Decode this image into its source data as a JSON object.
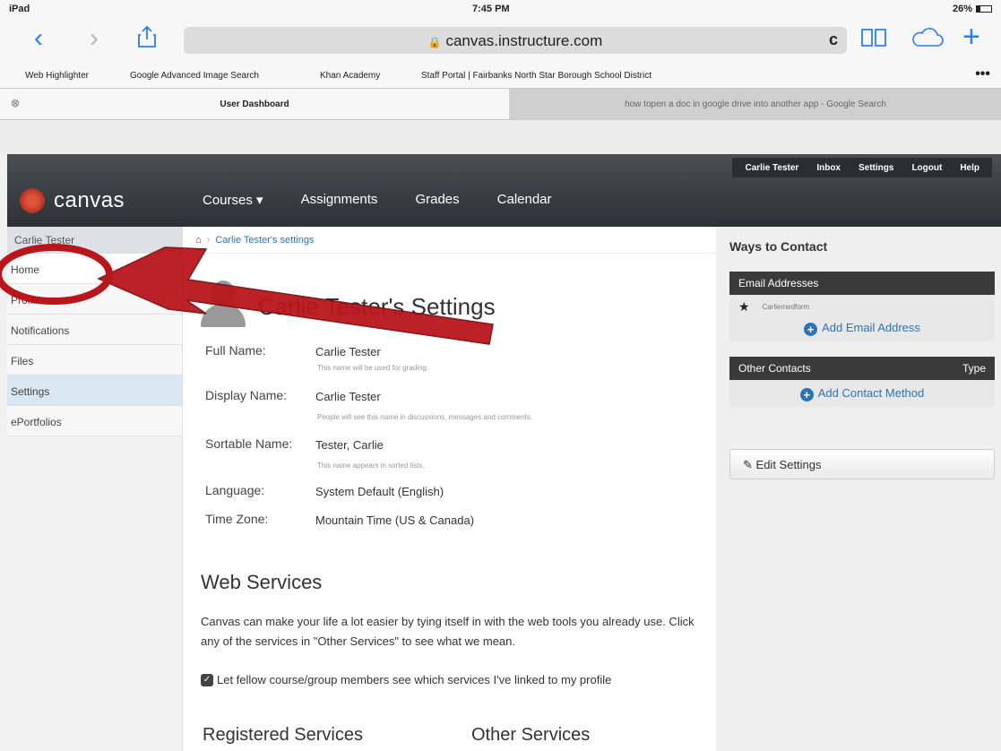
{
  "status_bar": {
    "device": "iPad",
    "time": "7:45 PM",
    "battery": "26%",
    "battery_level": 0.26
  },
  "browser": {
    "url": "canvas.instructure.com",
    "bookmarks": [
      "Web Highlighter",
      "Google Advanced Image Search",
      "Khan Academy",
      "Staff Portal | Fairbanks North Star Borough School District"
    ],
    "tabs": [
      {
        "title": "User Dashboard",
        "active": true
      },
      {
        "title": "how topen a doc in google drive into another app - Google Search",
        "active": false
      }
    ]
  },
  "header": {
    "logo": "canvas",
    "user_links": [
      "Carlie Tester",
      "Inbox",
      "Settings",
      "Logout",
      "Help"
    ],
    "nav": [
      "Courses ▾",
      "Assignments",
      "Grades",
      "Calendar"
    ]
  },
  "sidebar": {
    "user": "Carlie Tester",
    "items": [
      "Home",
      "Profile",
      "Notifications",
      "Files",
      "Settings",
      "ePortfolios"
    ]
  },
  "main": {
    "breadcrumb": "Carlie Tester's settings",
    "title": "Carlie Tester's Settings",
    "fields": [
      {
        "label": "Full Name:",
        "value": "Carlie Tester",
        "hint": "This name will be used for grading."
      },
      {
        "label": "Display Name:",
        "value": "Carlie Tester",
        "hint": "People will see this name in discussions, messages and comments."
      },
      {
        "label": "Sortable Name:",
        "value": "Tester, Carlie",
        "hint": "This name appears in sorted lists."
      },
      {
        "label": "Language:",
        "value": "System Default (English)",
        "hint": ""
      },
      {
        "label": "Time Zone:",
        "value": "Mountain Time (US & Canada)",
        "hint": ""
      }
    ],
    "web_services": {
      "title": "Web Services",
      "description": "Canvas can make your life a lot easier by tying itself in with the web tools you already use. Click any of the services in \"Other Services\" to see what we mean.",
      "checkbox_label": "Let fellow course/group members see which services I've linked to my profile",
      "registered_title": "Registered Services",
      "other_title": "Other Services"
    }
  },
  "right": {
    "ways_title": "Ways to Contact",
    "email_header": "Email Addresses",
    "email_value": "Carliemedform",
    "add_email": "Add Email Address",
    "other_contacts": "Other Contacts",
    "type_label": "Type",
    "add_contact": "Add Contact Method",
    "edit_settings": "Edit Settings"
  },
  "colors": {
    "canvas_header": "#3a3e43",
    "link": "#2a74b8",
    "annotation": "#c0161a",
    "safari_blue": "#2e7cf6"
  }
}
